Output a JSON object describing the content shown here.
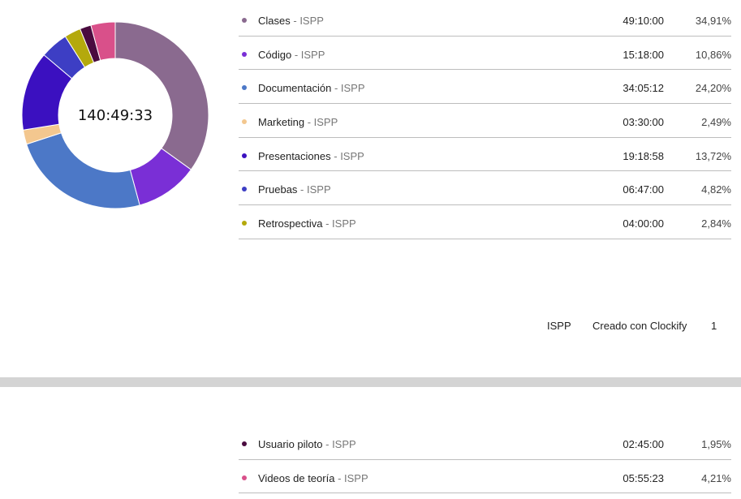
{
  "chart_data": {
    "type": "pie",
    "center_label": "140:49:33",
    "slices": [
      {
        "name": "Clases",
        "project": "ISPP",
        "duration": "49:10:00",
        "percent": 34.91,
        "percent_label": "34,91%",
        "color": "#8a6a8f"
      },
      {
        "name": "Código",
        "project": "ISPP",
        "duration": "15:18:00",
        "percent": 10.86,
        "percent_label": "10,86%",
        "color": "#7a2fd6"
      },
      {
        "name": "Documentación",
        "project": "ISPP",
        "duration": "34:05:12",
        "percent": 24.2,
        "percent_label": "24,20%",
        "color": "#4c78c7"
      },
      {
        "name": "Marketing",
        "project": "ISPP",
        "duration": "03:30:00",
        "percent": 2.49,
        "percent_label": "2,49%",
        "color": "#f3c78f"
      },
      {
        "name": "Presentaciones",
        "project": "ISPP",
        "duration": "19:18:58",
        "percent": 13.72,
        "percent_label": "13,72%",
        "color": "#3b10c0"
      },
      {
        "name": "Pruebas",
        "project": "ISPP",
        "duration": "06:47:00",
        "percent": 4.82,
        "percent_label": "4,82%",
        "color": "#3d3ec4"
      },
      {
        "name": "Retrospectiva",
        "project": "ISPP",
        "duration": "04:00:00",
        "percent": 2.84,
        "percent_label": "2,84%",
        "color": "#b4a90c"
      },
      {
        "name": "Usuario piloto",
        "project": "ISPP",
        "duration": "02:45:00",
        "percent": 1.95,
        "percent_label": "1,95%",
        "color": "#4a0b3f"
      },
      {
        "name": "Videos de teoría",
        "project": "ISPP",
        "duration": "05:55:23",
        "percent": 4.21,
        "percent_label": "4,21%",
        "color": "#d9508a"
      }
    ]
  },
  "footer": {
    "workspace": "ISPP",
    "created_with": "Creado con Clockify",
    "page_number": "1"
  }
}
